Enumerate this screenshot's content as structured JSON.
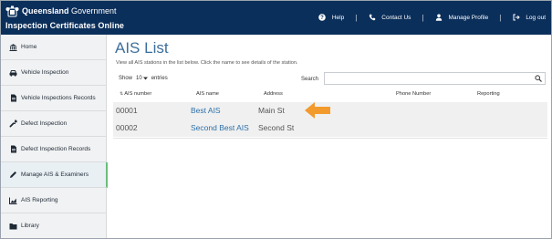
{
  "header": {
    "gov_name_bold": "Queensland",
    "gov_name_rest": " Government",
    "app_title": "Inspection Certificates Online",
    "links": [
      {
        "label": "Help",
        "icon": "help-circle-icon"
      },
      {
        "label": "Contact Us",
        "icon": "phone-icon"
      },
      {
        "label": "Manage Profile",
        "icon": "user-icon"
      },
      {
        "label": "Log out",
        "icon": "logout-icon"
      }
    ],
    "separator": "|"
  },
  "sidebar": {
    "items": [
      {
        "label": "Home",
        "icon": "bank-icon"
      },
      {
        "label": "Vehicle Inspection",
        "icon": "car-icon"
      },
      {
        "label": "Vehicle Inspections Records",
        "icon": "document-icon"
      },
      {
        "label": "Defect Inspection",
        "icon": "wrench-icon"
      },
      {
        "label": "Defect Inspection Records",
        "icon": "document-icon"
      },
      {
        "label": "Manage AIS & Examiners",
        "icon": "pencil-icon",
        "active": true
      },
      {
        "label": "AIS Reporting",
        "icon": "chart-icon"
      },
      {
        "label": "Library",
        "icon": "folder-icon"
      }
    ]
  },
  "main": {
    "title": "AIS List",
    "intro": "View all AIS stations in the list below. Click the name to see details of the station.",
    "show_label": "Show",
    "entries_value": "10",
    "entries_label": "entries",
    "search_label": "Search",
    "search_value": "",
    "columns": [
      "AIS number",
      "AIS name",
      "Address",
      "Phone Number",
      "Reporting"
    ],
    "rows": [
      {
        "number": "00001",
        "name": "Best AIS",
        "address": "Main St",
        "phone": "",
        "reporting": ""
      },
      {
        "number": "00002",
        "name": "Second Best AIS",
        "address": "Second St",
        "phone": "",
        "reporting": ""
      }
    ]
  },
  "colors": {
    "navbar": "#0b2f5b",
    "title": "#3d6f9c",
    "link": "#2d70a8",
    "active_accent": "#6cbd7a",
    "arrow": "#f39a2d"
  }
}
